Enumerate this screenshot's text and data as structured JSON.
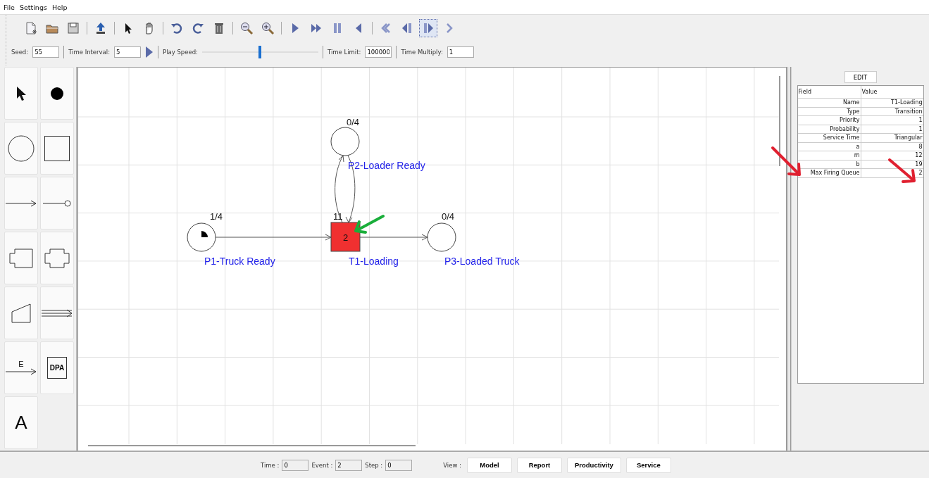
{
  "menu": [
    "File",
    "Settings",
    "Help"
  ],
  "toolbar": [
    {
      "kind": "new",
      "selected": false
    },
    {
      "kind": "open",
      "selected": false
    },
    {
      "kind": "save",
      "selected": false
    },
    {
      "kind": "separator"
    },
    {
      "kind": "export",
      "selected": false
    },
    {
      "kind": "separator"
    },
    {
      "kind": "pointer",
      "selected": false
    },
    {
      "kind": "hand",
      "selected": false
    },
    {
      "kind": "separator"
    },
    {
      "kind": "undo",
      "selected": false
    },
    {
      "kind": "redo",
      "selected": false
    },
    {
      "kind": "delete",
      "selected": false
    },
    {
      "kind": "separator"
    },
    {
      "kind": "zoom-out",
      "selected": false
    },
    {
      "kind": "zoom-in",
      "selected": false
    },
    {
      "kind": "separator"
    },
    {
      "kind": "play",
      "selected": false
    },
    {
      "kind": "fast-forward",
      "selected": false
    },
    {
      "kind": "pause",
      "selected": false
    },
    {
      "kind": "play-back",
      "selected": false
    },
    {
      "kind": "separator"
    },
    {
      "kind": "rewind",
      "selected": false
    },
    {
      "kind": "step-back",
      "selected": false
    },
    {
      "kind": "step-forward",
      "selected": true
    },
    {
      "kind": "next",
      "selected": false
    }
  ],
  "settings": {
    "seed_label": "Seed:",
    "seed": "55",
    "interval_label": "Time Interval:",
    "interval": "5",
    "speed_label": "Play Speed:",
    "speed": {
      "level": 0.5
    },
    "limit_label": "Time Limit:",
    "limit": "100000",
    "multiply_label": "Time Multiply:",
    "multiply": "1"
  },
  "palette": [
    {
      "kind": "pointer"
    },
    {
      "kind": "token"
    },
    {
      "kind": "place"
    },
    {
      "kind": "transition"
    },
    {
      "kind": "arc"
    },
    {
      "kind": "inhibitor-arc"
    },
    {
      "kind": "macro-place"
    },
    {
      "kind": "macro-transition"
    },
    {
      "kind": "trapezoid"
    },
    {
      "kind": "multi-arc"
    },
    {
      "kind": "event-arc",
      "label": "E"
    },
    {
      "kind": "dpa",
      "label": "DPA"
    },
    {
      "kind": "text",
      "label": "A"
    }
  ],
  "diagram": {
    "nodes": [
      {
        "kind": "place",
        "marking": "1/4",
        "label": "P1-Truck Ready"
      },
      {
        "kind": "transition",
        "marking": "11",
        "label": "T1-Loading",
        "count": "2",
        "firing": true
      },
      {
        "kind": "place",
        "marking": "0/4",
        "label": "P3-Loaded Truck"
      },
      {
        "kind": "place",
        "marking": "0/4",
        "label": "P2-Loader Ready"
      }
    ]
  },
  "properties": {
    "button": "EDIT",
    "columns": [
      "Field",
      "Value"
    ],
    "rows": [
      {
        "field": "Name",
        "value": "T1-Loading"
      },
      {
        "field": "Type",
        "value": "Transition"
      },
      {
        "field": "Priority",
        "value": "1"
      },
      {
        "field": "Probability",
        "value": "1"
      },
      {
        "field": "Service Time",
        "value": "Triangular"
      },
      {
        "field": "a",
        "value": "8"
      },
      {
        "field": "m",
        "value": "12"
      },
      {
        "field": "b",
        "value": "19"
      },
      {
        "field": "Max Firing Queue",
        "value": "2"
      }
    ]
  },
  "status": {
    "time_label": "Time :",
    "time": "0",
    "event_label": "Event :",
    "event": "2",
    "step_label": "Step :",
    "step": "0",
    "view_label": "View :",
    "buttons": [
      "Model",
      "Report",
      "Productivity",
      "Service"
    ]
  }
}
